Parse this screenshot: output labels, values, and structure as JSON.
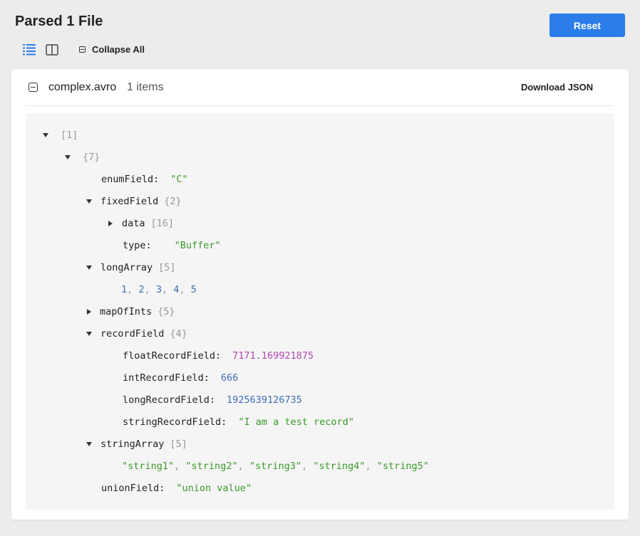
{
  "header": {
    "title": "Parsed 1 File",
    "reset_label": "Reset",
    "collapse_all_label": "Collapse All"
  },
  "panel": {
    "file_name": "complex.avro",
    "item_count": "1 items",
    "download_label": "Download JSON"
  },
  "tree": {
    "root_count": "[1]",
    "object_count": "{7}",
    "enumField": {
      "key": "enumField:",
      "value": "\"C\""
    },
    "fixedField": {
      "key": "fixedField",
      "count": "{2}"
    },
    "data": {
      "key": "data",
      "count": "[16]"
    },
    "type": {
      "key": "type:",
      "value": "\"Buffer\""
    },
    "longArray": {
      "key": "longArray",
      "count": "[5]",
      "values": [
        "1",
        "2",
        "3",
        "4",
        "5"
      ]
    },
    "mapOfInts": {
      "key": "mapOfInts",
      "count": "{5}"
    },
    "recordField": {
      "key": "recordField",
      "count": "{4}"
    },
    "floatRecordField": {
      "key": "floatRecordField:",
      "value": "7171.169921875"
    },
    "intRecordField": {
      "key": "intRecordField:",
      "value": "666"
    },
    "longRecordField": {
      "key": "longRecordField:",
      "value": "1925639126735"
    },
    "stringRecordField": {
      "key": "stringRecordField:",
      "value": "\"I am a test record\""
    },
    "stringArray": {
      "key": "stringArray",
      "count": "[5]",
      "values": [
        "\"string1\"",
        "\"string2\"",
        "\"string3\"",
        "\"string4\"",
        "\"string5\""
      ]
    },
    "unionField": {
      "key": "unionField:",
      "value": "\"union value\""
    }
  },
  "colors": {
    "accent": "#2b7de9",
    "string": "#3a9a2a",
    "number": "#3d6fb5",
    "float": "#b044b3",
    "meta": "#999999"
  },
  "icons": [
    "list-view-icon",
    "split-view-icon",
    "collapse-square-icon",
    "caret-down-icon",
    "caret-right-icon"
  ]
}
